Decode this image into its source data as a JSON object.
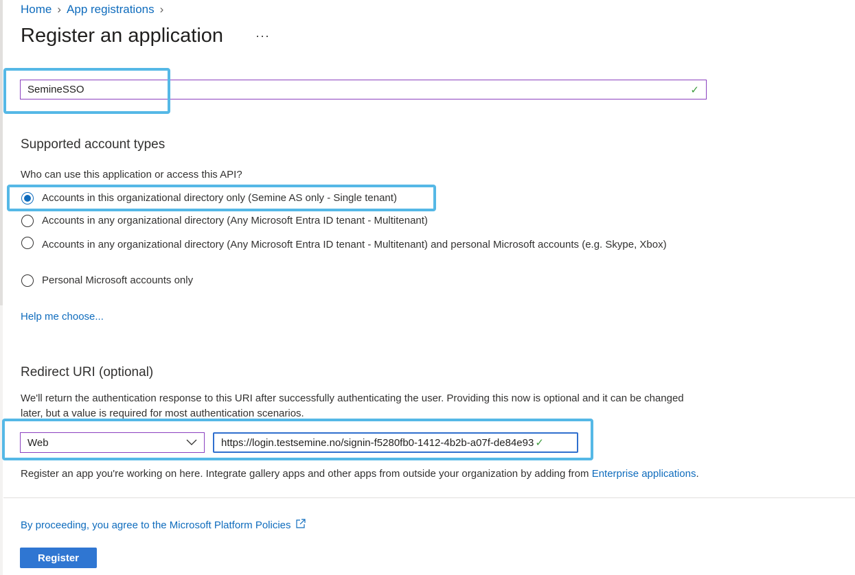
{
  "breadcrumb": [
    {
      "label": "Home"
    },
    {
      "label": "App registrations"
    }
  ],
  "page": {
    "title": "Register an application",
    "more_label": "···"
  },
  "name_field": {
    "value": "SemineSSO",
    "valid_icon": "checkmark-icon"
  },
  "account_types": {
    "heading": "Supported account types",
    "question": "Who can use this application or access this API?",
    "options": [
      {
        "label": "Accounts in this organizational directory only (Semine AS only - Single tenant)",
        "selected": true
      },
      {
        "label": "Accounts in any organizational directory (Any Microsoft Entra ID tenant - Multitenant)",
        "selected": false
      },
      {
        "label": "Accounts in any organizational directory (Any Microsoft Entra ID tenant - Multitenant) and personal Microsoft accounts (e.g. Skype, Xbox)",
        "selected": false
      },
      {
        "label": "Personal Microsoft accounts only",
        "selected": false
      }
    ],
    "help_link": "Help me choose..."
  },
  "redirect": {
    "heading": "Redirect URI (optional)",
    "description": "We'll return the authentication response to this URI after successfully authenticating the user. Providing this now is optional and it can be changed later, but a value is required for most authentication scenarios.",
    "platform": "Web",
    "uri": "https://login.testsemine.no/signin-f5280fb0-1412-4b2b-a07f-de84e93"
  },
  "note": {
    "text": "Register an app you're working on here. Integrate gallery apps and other apps from outside your organization by adding from ",
    "link": "Enterprise applications",
    "end": "."
  },
  "policy_link": "By proceeding, you agree to the Microsoft Platform Policies",
  "register_label": "Register",
  "colors": {
    "accent": "#0f6cbd",
    "button": "#2f76d2",
    "highlight": "#55b8e6",
    "field_border": "#8a3fbf"
  }
}
